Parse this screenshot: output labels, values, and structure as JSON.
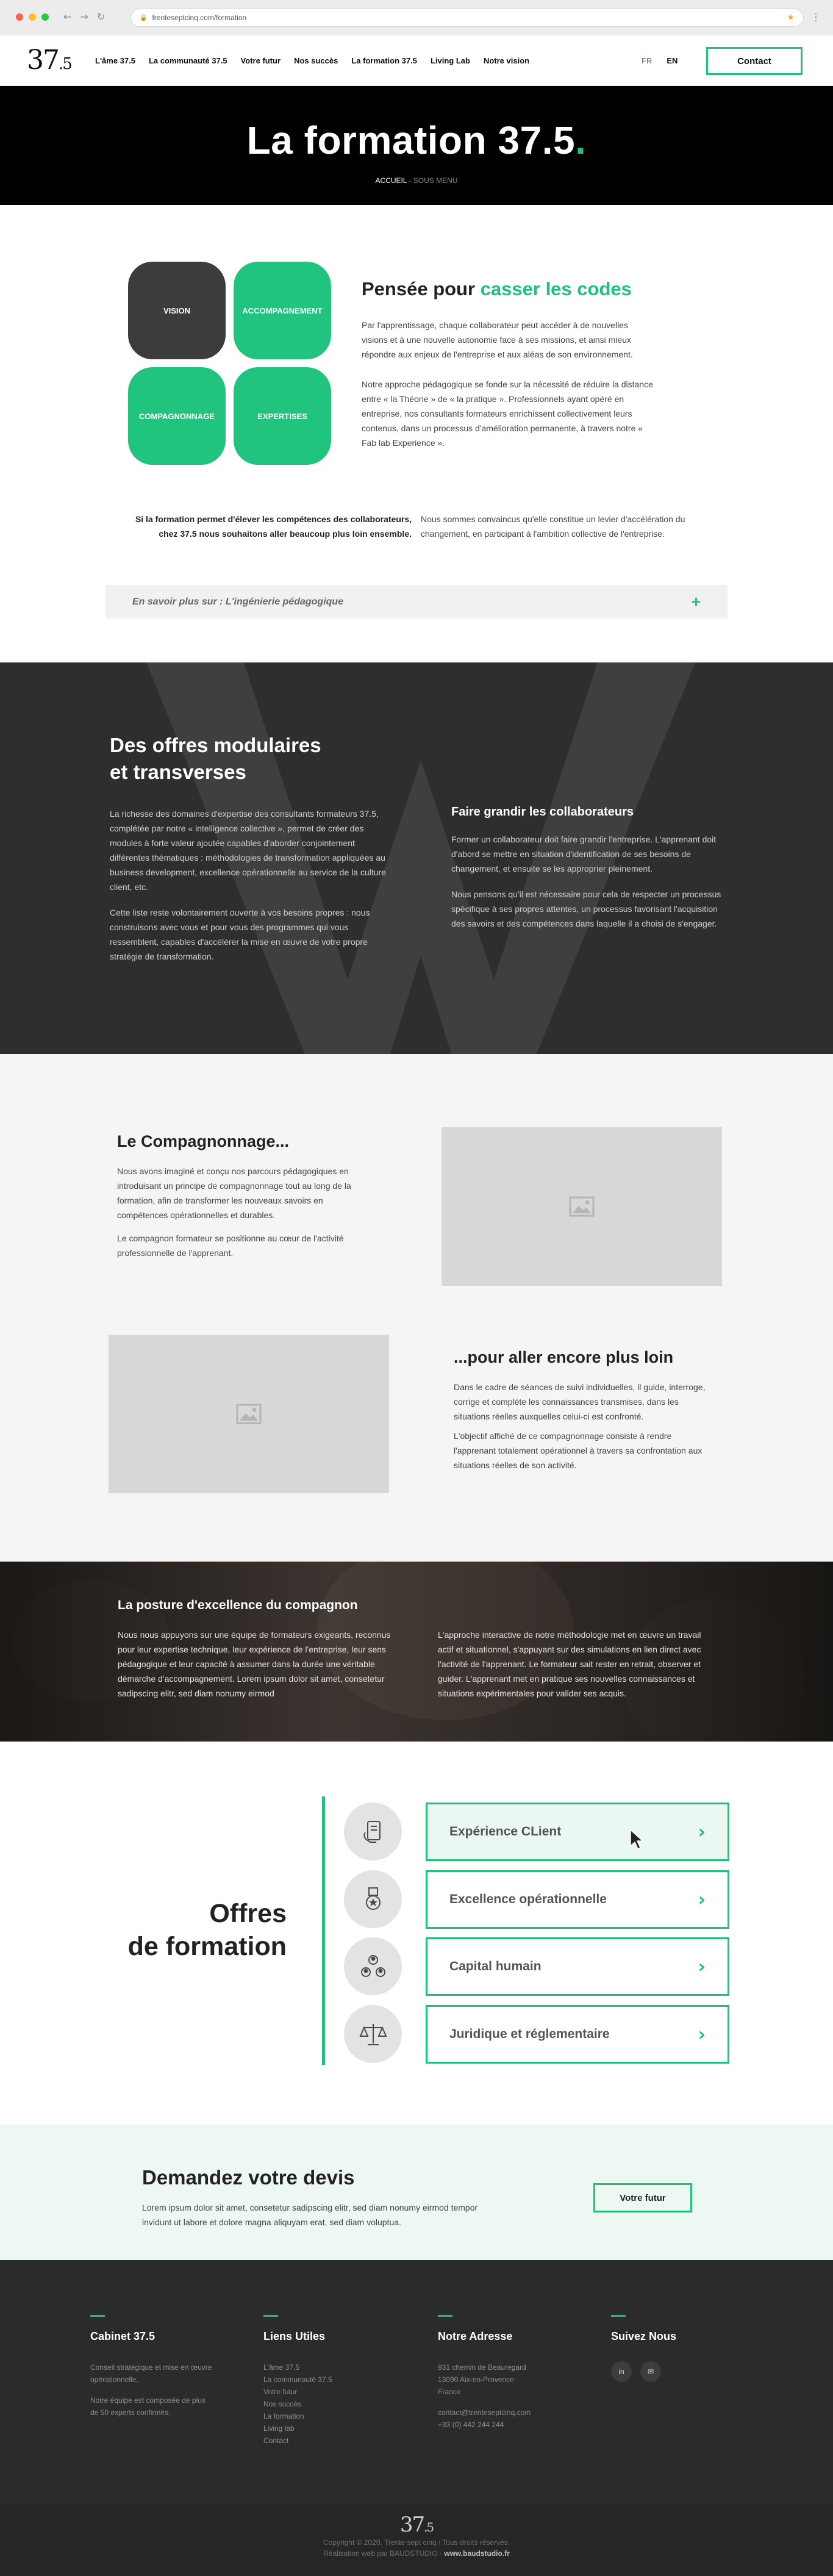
{
  "browser": {
    "url": "frenteseptcinq.com/formation",
    "back_glyph": "←",
    "forward_glyph": "→",
    "reload_glyph": "↻",
    "star_glyph": "★",
    "menu_glyph": "⋮",
    "lock_glyph": "🔒",
    "traffic_colors": [
      "#ff5f57",
      "#febc2e",
      "#28c840"
    ]
  },
  "header": {
    "logo_main": "37",
    "logo_small": ".5",
    "nav": [
      "L'âme 37.5",
      "La communauté 37.5",
      "Votre futur",
      "Nos succès",
      "La formation 37.5",
      "Living Lab",
      "Notre vision"
    ],
    "lang_fr": "FR",
    "lang_en": "EN",
    "contact_label": "Contact"
  },
  "hero": {
    "title": "La formation 37.5",
    "title_dot": ".",
    "breadcrumb_home": "ACCUEIL",
    "breadcrumb_sep": " - ",
    "breadcrumb_sub": "SOUS MENU"
  },
  "intro": {
    "tiles": [
      "VISION",
      "ACCOMPAGNEMENT",
      "COMPAGNONNAGE",
      "EXPERTISES"
    ],
    "heading_prefix": "Pensée pour ",
    "heading_accent": "casser les codes",
    "para1": "Par l'apprentissage, chaque collaborateur peut accéder à de nouvelles visions et à une nouvelle autonomie face à ses missions, et ainsi mieux répondre aux enjeux de l'entreprise et aux aléas de son environnement.",
    "para2": "Notre approche pédagogique se fonde sur la nécessité de réduire la distance entre « la Théorie » de « la pratique ». Professionnels ayant opéré en entreprise, nos consultants formateurs enrichissent collectivement leurs contenus, dans un processus d'amélioration permanente, à travers notre « Fab lab Experience ».",
    "bold_statement": "Si la formation permet d'élever les compétences des collaborateurs, chez 37.5 nous souhaitons aller beaucoup plus loin ensemble.",
    "right_note": "Nous sommes convaincus qu'elle constitue un levier d'accélération du changement, en participant à l'ambition collective de l'entreprise.",
    "accordion_label": "En savoir plus sur : L'ingénierie pédagogique",
    "accordion_plus": "+"
  },
  "modulaires": {
    "heading_line1": "Des offres modulaires",
    "heading_line2": "et transverses",
    "left_para1": "La richesse des domaines d'expertise des consultants formateurs 37.5, complétée par notre « intelligence collective », permet de créer des modules à forte valeur ajoutée capables d'aborder conjointement différentes thématiques : méthodologies de transformation appliquées au business development, excellence opérationnelle au service de la culture client, etc.",
    "left_para2": "Cette liste reste volontairement ouverte à vos besoins propres : nous construisons avec vous et pour vous des programmes qui vous ressemblent, capables d'accélérer la mise en œuvre de votre propre stratégie de transformation.",
    "right_heading": "Faire grandir les collaborateurs",
    "right_para1": "Former un collaborateur doit faire grandir l'entreprise. L'apprenant doit d'abord se mettre en situation d'identification de ses besoins de changement, et ensuite se les approprier pleinement.",
    "right_para2": "Nous pensons qu'il est nécessaire pour cela de respecter un processus spécifique à ses propres attentes, un processus favorisant l'acquisition des savoirs et des compétences dans laquelle il a choisi de s'engager."
  },
  "compagnonnage": {
    "heading1": "Le Compagnonnage...",
    "para1a": "Nous avons imaginé et conçu nos parcours pédagogiques en introduisant un principe de compagnonnage tout au long de la formation, afin de transformer les nouveaux savoirs en compétences opérationnelles et durables.",
    "para1b": "Le compagnon formateur se positionne au cœur de l'activité professionnelle de l'apprenant.",
    "heading2": "...pour aller encore plus loin",
    "para2a": "Dans le cadre de séances de suivi individuelles, il guide, interroge, corrige et complète les connaissances transmises, dans les situations réelles auxquelles celui-ci est confronté.",
    "para2b": "L'objectif affiché de ce compagnonnage consiste à rendre l'apprenant totalement opérationnel à travers sa confrontation aux situations réelles de son activité.",
    "image_icon": "image-icon"
  },
  "posture": {
    "heading": "La posture d'excellence du compagnon",
    "left_para": "Nous nous appuyons sur une équipe de formateurs exigeants, reconnus pour leur expertise technique, leur expérience de l'entreprise, leur sens pédagogique et leur capacité à assumer dans la durée une véritable démarche d'accompagnement. Lorem ipsum dolor sit amet, consetetur sadipscing elitr, sed diam nonumy eirmod",
    "right_para": "L'approche interactive de notre méthodologie met en œuvre un travail actif et situationnel, s'appuyant sur des simulations en lien direct avec l'activité de l'apprenant. Le formateur sait rester en retrait, observer et guider. L'apprenant met en pratique ses nouvelles connaissances et situations expérimentales pour valider ses acquis."
  },
  "offres": {
    "heading_line1": "Offres",
    "heading_line2": "de formation",
    "chevron": "›",
    "items": [
      {
        "label": "Expérience CLient",
        "icon": "customer-experience-icon"
      },
      {
        "label": "Excellence opérationnelle",
        "icon": "medal-icon"
      },
      {
        "label": "Capital humain",
        "icon": "people-group-icon"
      },
      {
        "label": "Juridique et réglementaire",
        "icon": "scales-icon"
      }
    ]
  },
  "devis": {
    "heading": "Demandez votre devis",
    "text": "Lorem ipsum dolor sit amet, consetetur sadipscing elitr, sed diam nonumy eirmod tempor invidunt ut labore et dolore magna aliquyam erat, sed diam voluptua.",
    "button": "Votre futur"
  },
  "footer": {
    "col1_title": "Cabinet 37.5",
    "col1_text1": "Conseil stratégique et mise en œuvre opérationnelle.",
    "col1_text2": "Notre équipe est composée de plus de 50 experts confirmés.",
    "col2_title": "Liens Utiles",
    "col2_links": [
      "L'âme 37.5",
      "La communauté 37.5",
      "Votre futur",
      "Nos succès",
      "La formation",
      "Living lab",
      "Contact"
    ],
    "col3_title": "Notre Adresse",
    "col3_addr": [
      "931 chemin de Beauregard",
      "13090 Aix-en-Provence",
      "France"
    ],
    "col3_email": "contact@trenteseptcinq.com",
    "col3_phone": "+33 (0) 442 244 244",
    "col4_title": "Suivez Nous",
    "social": [
      {
        "icon": "linkedin-icon",
        "glyph": "in"
      },
      {
        "icon": "email-icon",
        "glyph": "✉"
      }
    ],
    "copyright": "Copyright © 2020. Trente sept cinq / Tous droits réservés.",
    "credit_prefix": "Réalisation web par BAUDSTUDIO",
    "credit_link": "www.baudstudio.fr"
  },
  "colors": {
    "accent": "#20c27a",
    "dark": "#2e2e2e",
    "tile_dark": "#3c3c3c"
  }
}
